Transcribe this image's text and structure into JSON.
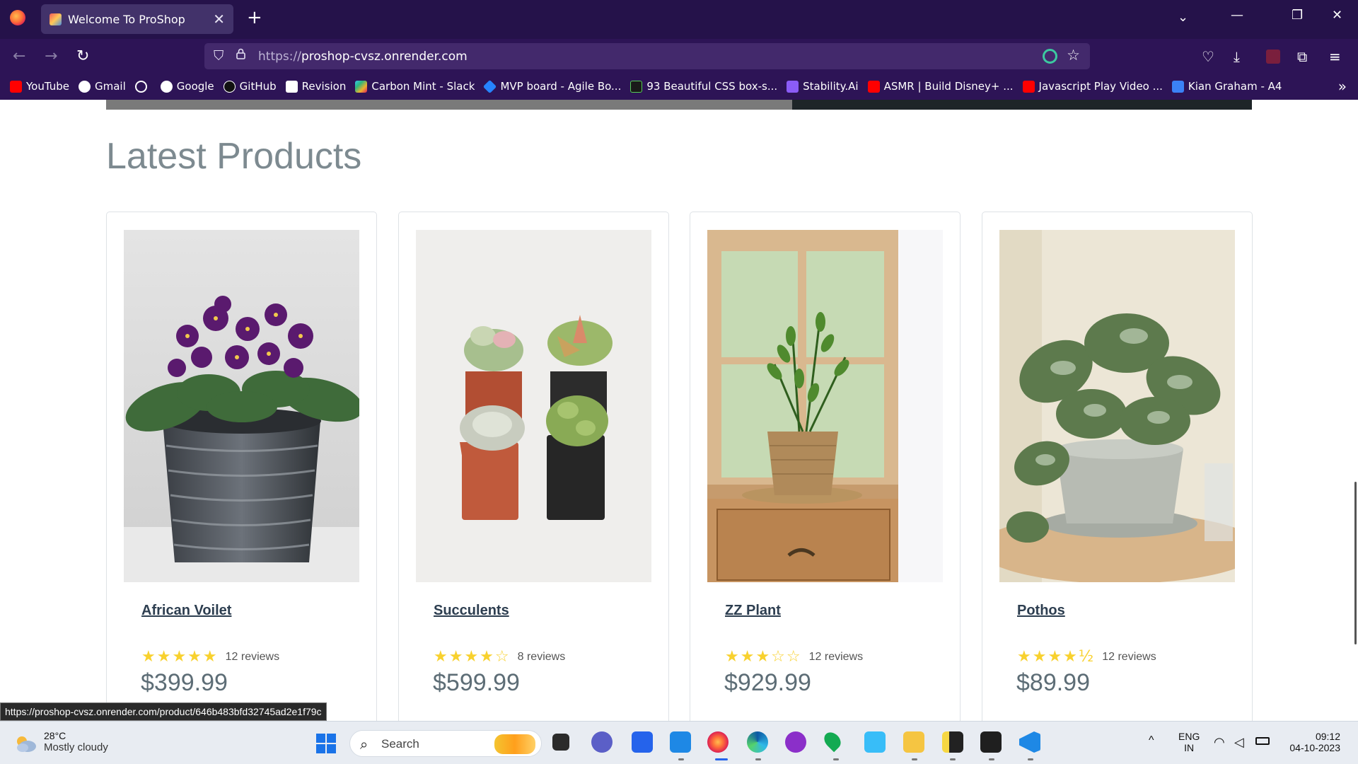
{
  "browser": {
    "tab_title": "Welcome To ProShop",
    "url_protocol": "https://",
    "url_host": "proshop-cvsz.onrender.com",
    "bookmarks": [
      {
        "label": "YouTube",
        "color": "#ff0000"
      },
      {
        "label": "Gmail",
        "color": "#ffffff"
      },
      {
        "label": "",
        "color": "#ffffff"
      },
      {
        "label": "Google",
        "color": "#ffffff"
      },
      {
        "label": "GitHub",
        "color": "#000000"
      },
      {
        "label": "Revision",
        "color": "#ffffff"
      },
      {
        "label": "Carbon Mint - Slack",
        "color": "#e01e5a"
      },
      {
        "label": "MVP board - Agile Bo...",
        "color": "#2684ff"
      },
      {
        "label": "93 Beautiful CSS box-s...",
        "color": "#1a1a1a"
      },
      {
        "label": "Stability.Ai",
        "color": "#8b5cf6"
      },
      {
        "label": "ASMR | Build Disney+ ...",
        "color": "#ff0000"
      },
      {
        "label": "Javascript Play Video ...",
        "color": "#ff0000"
      },
      {
        "label": "Kian Graham - A4",
        "color": "#3b82f6"
      }
    ]
  },
  "page": {
    "section_title": "Latest Products",
    "products": [
      {
        "name": "African Voilet",
        "stars": "★★★★★",
        "reviews": "12 reviews",
        "price": "$399.99",
        "rating": 5
      },
      {
        "name": "Succulents",
        "stars": "★★★★☆",
        "reviews": "8 reviews",
        "price": "$599.99",
        "rating": 4
      },
      {
        "name": "ZZ Plant",
        "stars": "★★★☆☆",
        "reviews": "12 reviews",
        "price": "$929.99",
        "rating": 3
      },
      {
        "name": "Pothos",
        "stars": "★★★★½",
        "reviews": "12 reviews",
        "price": "$89.99",
        "rating": 4.5
      }
    ],
    "status_link": "https://proshop-cvsz.onrender.com/product/646b483bfd32745ad2e1f79c"
  },
  "taskbar": {
    "weather_temp": "28°C",
    "weather_cond": "Mostly cloudy",
    "search_label": "Search",
    "lang_top": "ENG",
    "lang_bottom": "IN",
    "time": "09:12",
    "date": "04-10-2023"
  }
}
